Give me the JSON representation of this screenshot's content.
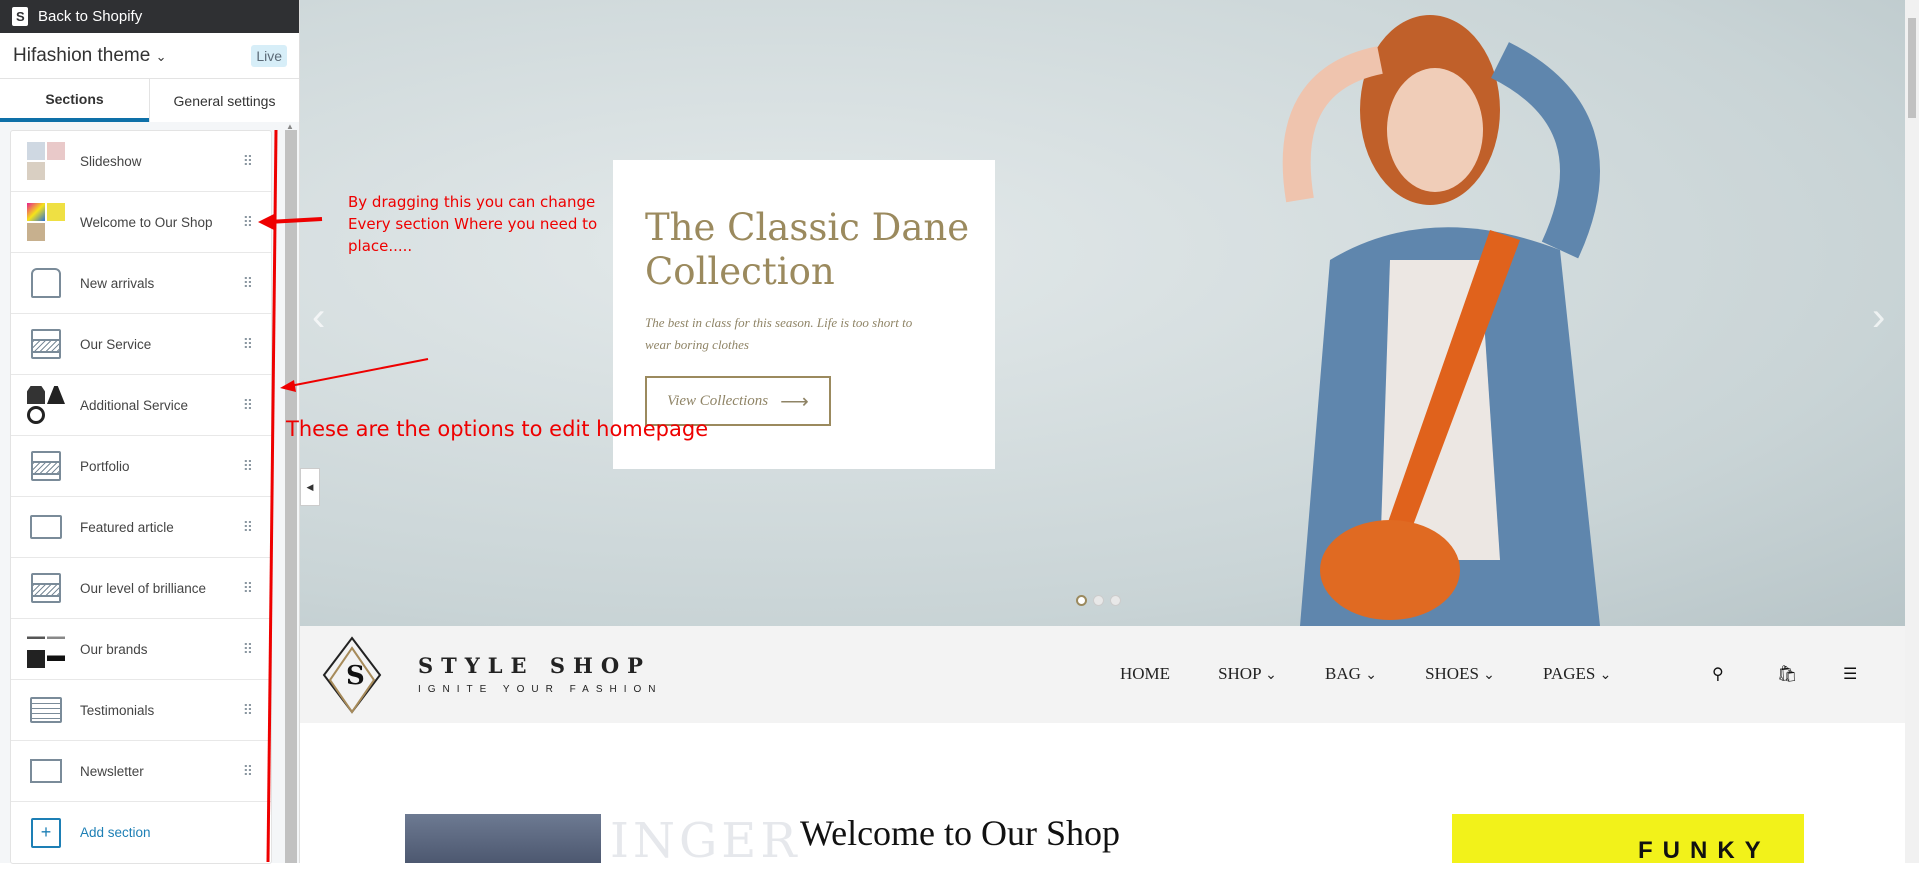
{
  "sidebar": {
    "back_label": "Back to Shopify",
    "theme_name": "Hifashion theme",
    "theme_status": "Live",
    "tabs": [
      {
        "label": "Sections"
      },
      {
        "label": "General settings"
      }
    ],
    "items": [
      {
        "label": "Slideshow",
        "icon": "image-thumbnails"
      },
      {
        "label": "Welcome to Our Shop",
        "icon": "image-thumbnails"
      },
      {
        "label": "New arrivals",
        "icon": "tags-icon"
      },
      {
        "label": "Our Service",
        "icon": "section-icon"
      },
      {
        "label": "Additional Service",
        "icon": "clothing-thumbnails"
      },
      {
        "label": "Portfolio",
        "icon": "section-icon"
      },
      {
        "label": "Featured article",
        "icon": "speech-bubble-icon"
      },
      {
        "label": "Our level of brilliance",
        "icon": "section-icon"
      },
      {
        "label": "Our brands",
        "icon": "brand-logos"
      },
      {
        "label": "Testimonials",
        "icon": "testimonial-icon"
      },
      {
        "label": "Newsletter",
        "icon": "envelope-icon"
      }
    ],
    "add_section": "Add section"
  },
  "annotations": {
    "drag_note": [
      "By dragging this you can change",
      "Every section Where you need to",
      "place....."
    ],
    "options_note": "These are the options to edit homepage",
    "color": "#e00000"
  },
  "hero": {
    "title": "The Classic Dane Collection",
    "subtitle": "The best in class for this season. Life is too short to wear boring clothes",
    "button": "View Collections",
    "accent": "#9b8a5e"
  },
  "store_nav": {
    "brand": "STYLE SHOP",
    "tagline": "IGNITE YOUR FASHION",
    "menu": [
      "HOME",
      "SHOP",
      "BAG",
      "SHOES",
      "PAGES"
    ]
  },
  "welcome": {
    "title": "Welcome to Our Shop",
    "left_image_text": "INGER",
    "right_image_text": "FUNKY"
  }
}
